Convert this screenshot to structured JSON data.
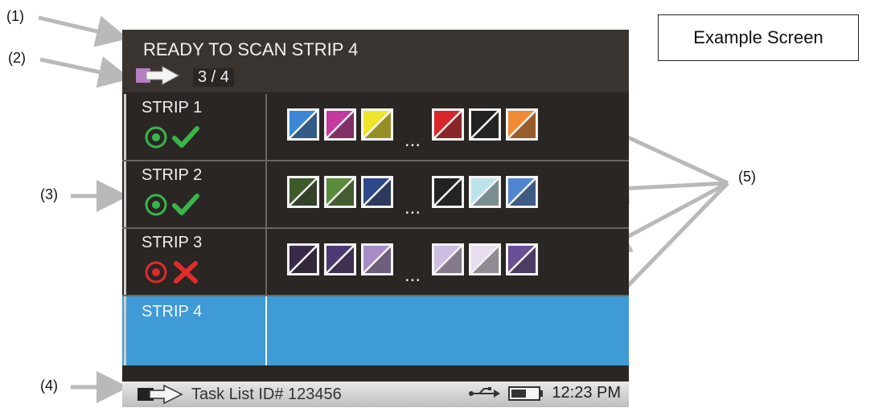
{
  "callouts": [
    "(1)",
    "(2)",
    "(3)",
    "(4)",
    "(5)"
  ],
  "example_label": "Example Screen",
  "header": {
    "title": "READY TO SCAN STRIP 4",
    "progress": "3 / 4"
  },
  "strips": [
    {
      "name": "STRIP 1",
      "status": "pass",
      "patch_colors": [
        "#3b87d6",
        "#c6399e",
        "#efe52a",
        "#d9262a",
        "#222222",
        "#f08a33"
      ]
    },
    {
      "name": "STRIP 2",
      "status": "pass",
      "patch_colors": [
        "#3c5a2a",
        "#5a8b3a",
        "#2f4a8a",
        "#222222",
        "#bde3ea",
        "#4f86cf"
      ]
    },
    {
      "name": "STRIP 3",
      "status": "fail",
      "patch_colors": [
        "#3a2a4a",
        "#4e3a73",
        "#a68bc6",
        "#cdbde0",
        "#e8dcef",
        "#6a4e96"
      ]
    },
    {
      "name": "STRIP 4",
      "status": "active",
      "patch_colors": []
    }
  ],
  "ellipsis": "...",
  "footer": {
    "task_list": "Task List ID# 123456",
    "time": "12:23 PM"
  },
  "colors": {
    "pass": "#39b54a",
    "fail": "#e02b2b",
    "active": "#3f9bd6",
    "arrow_gray": "#b9b9b9"
  }
}
